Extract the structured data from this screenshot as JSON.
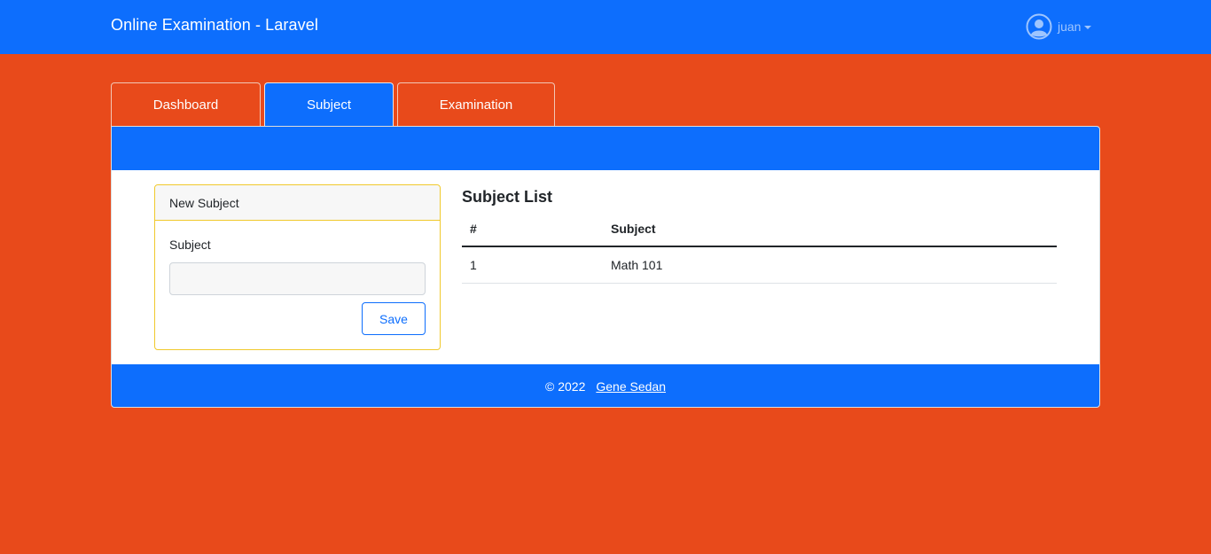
{
  "navbar": {
    "brand": "Online Examination - Laravel",
    "user": {
      "name": "juan",
      "icon": "user-circle-icon"
    }
  },
  "tabs": [
    {
      "label": "Dashboard",
      "active": false
    },
    {
      "label": "Subject",
      "active": true
    },
    {
      "label": "Examination",
      "active": false
    }
  ],
  "form": {
    "title": "New Subject",
    "field_label": "Subject",
    "field_value": "",
    "save_label": "Save"
  },
  "list": {
    "title": "Subject List",
    "columns": [
      "#",
      "Subject"
    ],
    "rows": [
      {
        "num": "1",
        "subject": "Math 101"
      }
    ]
  },
  "footer": {
    "copyright": "© 2022",
    "author": "Gene Sedan"
  },
  "colors": {
    "background": "#e84a1b",
    "primary": "#0d6efd",
    "form_border": "#f0c92c"
  }
}
